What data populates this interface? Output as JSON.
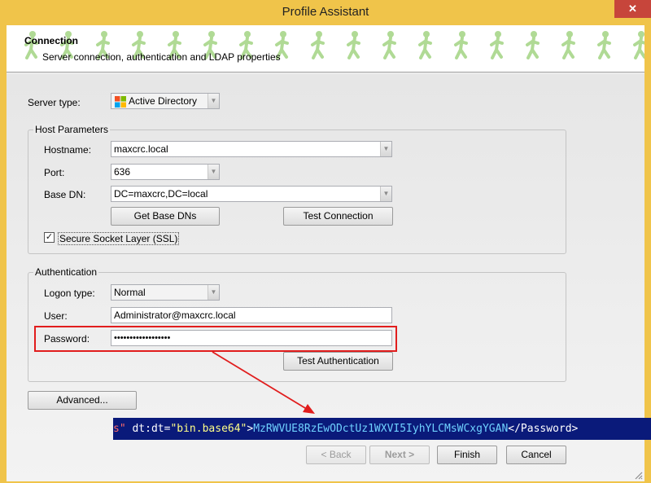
{
  "window": {
    "title": "Profile Assistant",
    "close_glyph": "✕"
  },
  "header": {
    "title": "Connection",
    "subtitle": "Server connection, authentication and LDAP properties"
  },
  "server_type": {
    "label": "Server type:",
    "value": "Active Directory",
    "icon": "windows-logo-icon"
  },
  "host": {
    "group_title": "Host Parameters",
    "hostname_label": "Hostname:",
    "hostname_value": "maxcrc.local",
    "port_label": "Port:",
    "port_value": "636",
    "basedn_label": "Base DN:",
    "basedn_value": "DC=maxcrc,DC=local",
    "get_base_dns": "Get Base DNs",
    "test_connection": "Test Connection",
    "ssl_label": "Secure Socket Layer (SSL)",
    "ssl_checked": true
  },
  "auth": {
    "group_title": "Authentication",
    "logon_label": "Logon type:",
    "logon_value": "Normal",
    "user_label": "User:",
    "user_value": "Administrator@maxcrc.local",
    "password_label": "Password:",
    "password_value": "••••••••••••••••••",
    "test_auth": "Test Authentication"
  },
  "advanced_button": "Advanced...",
  "footer": {
    "back": "< Back",
    "next": "Next >",
    "finish": "Finish",
    "cancel": "Cancel"
  },
  "xml_overlay": {
    "prefix": "s\"",
    "attr": " dt:dt=",
    "attr_value": "\"bin.base64\"",
    "gt": ">",
    "content": "MzRWVUE8RzEwODctUz1WXVI5IyhYLCMsWCxgYGAN",
    "close_tag": "</Password>"
  },
  "colors": {
    "frame": "#f0c44a",
    "close": "#c7453b",
    "highlight": "#e11d1d",
    "overlay_bg": "#0a1a7a",
    "figure": "#a8d68a"
  }
}
